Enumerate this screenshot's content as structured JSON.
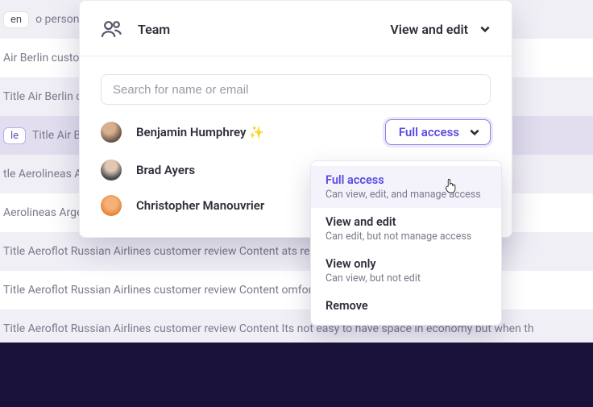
{
  "background_rows": [
    {
      "tag": "en",
      "text": "o personal ente"
    },
    {
      "tag": "",
      "text": "Air Berlin customer h like this is tor"
    },
    {
      "tag": "",
      "text": "Title Air Berlin c It was of cours"
    },
    {
      "tag": "le",
      "text": "Title Air Be n my legs are s",
      "highlight": true
    },
    {
      "tag": "",
      "text": "tle Aerolineas A andards very sp"
    },
    {
      "tag": "",
      "text": "Aerolineas Argentinas ght product wit"
    },
    {
      "tag": "",
      "text": "Title Aeroflot Russian Airlines customer review Content ats recline well."
    },
    {
      "tag": "",
      "text": "Title Aeroflot Russian Airlines customer review Content omfortable as or"
    },
    {
      "tag": "",
      "text": "Title Aeroflot Russian Airlines customer review Content Its not easy to have space in economy but when th"
    }
  ],
  "header": {
    "team_label": "Team",
    "access_label": "View and edit"
  },
  "search": {
    "placeholder": "Search for name or email"
  },
  "users": [
    {
      "name": "Benjamin Humphrey",
      "sparkle": "✨",
      "access": "Full access"
    },
    {
      "name": "Brad Ayers"
    },
    {
      "name": "Christopher Manouvrier"
    }
  ],
  "popover_options": [
    {
      "title": "Full access",
      "desc": "Can view, edit, and manage access",
      "active": true
    },
    {
      "title": "View and edit",
      "desc": "Can edit, but not manage access"
    },
    {
      "title": "View only",
      "desc": "Can view, but not edit"
    },
    {
      "title": "Remove"
    }
  ]
}
